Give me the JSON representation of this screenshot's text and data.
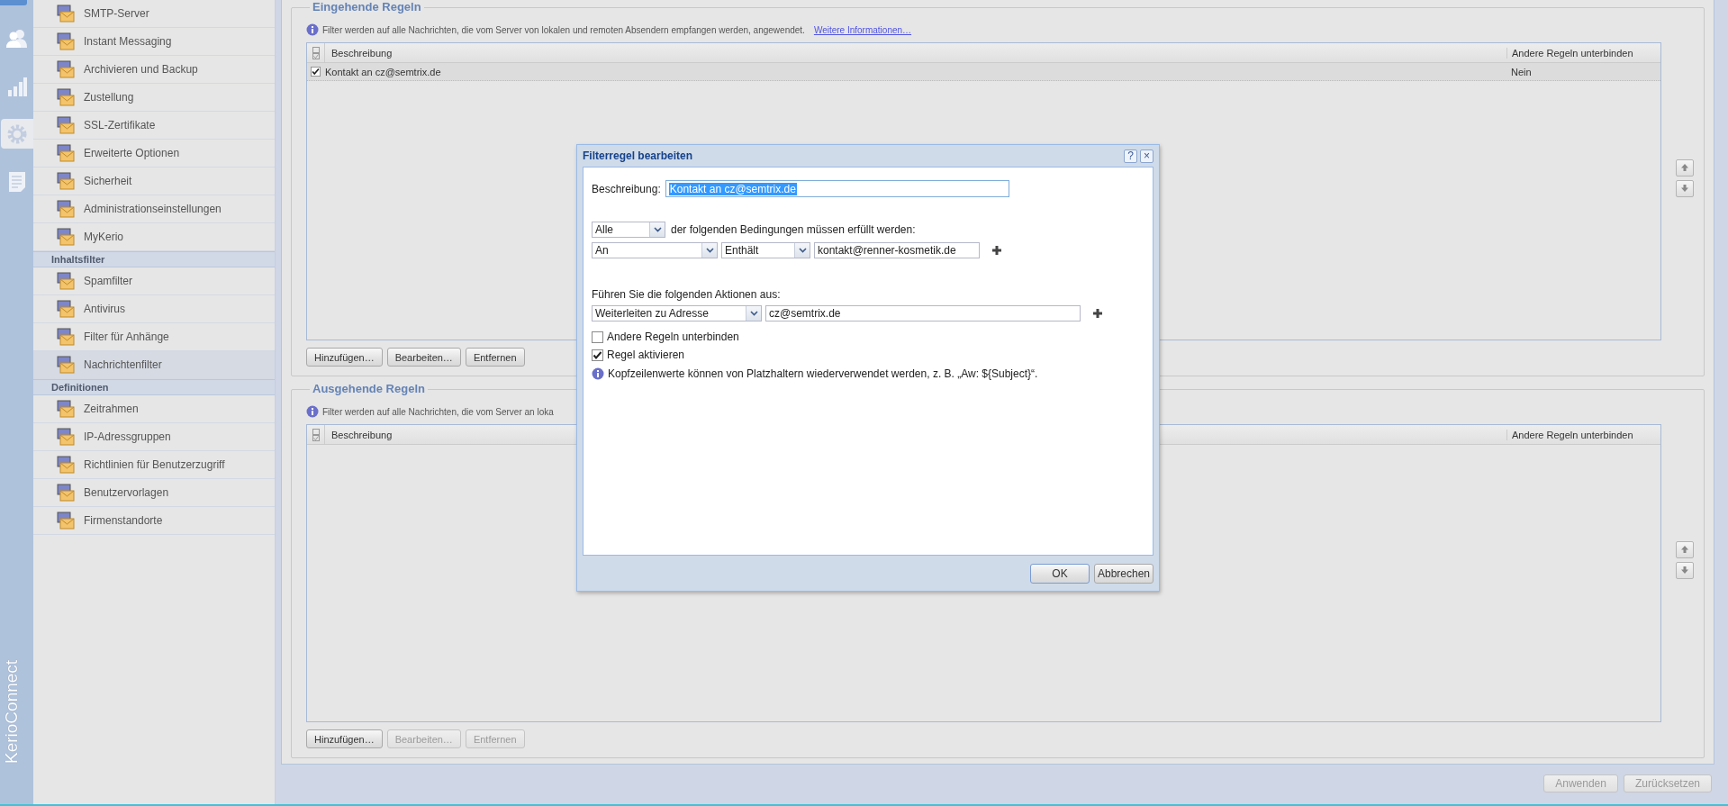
{
  "rail": {
    "items": [
      {
        "selected": false
      },
      {
        "selected": false
      },
      {
        "selected": true
      },
      {
        "selected": false
      }
    ],
    "brand": "KerioConnect"
  },
  "sidebar": {
    "groups": [
      {
        "items": [
          {
            "label": "SMTP-Server",
            "selected": false
          },
          {
            "label": "Instant Messaging",
            "selected": false
          },
          {
            "label": "Archivieren und Backup",
            "selected": false
          },
          {
            "label": "Zustellung",
            "selected": false
          },
          {
            "label": "SSL-Zertifikate",
            "selected": false
          },
          {
            "label": "Erweiterte Optionen",
            "selected": false
          },
          {
            "label": "Sicherheit",
            "selected": false
          },
          {
            "label": "Administrationseinstellungen",
            "selected": false
          },
          {
            "label": "MyKerio",
            "selected": false
          }
        ]
      },
      {
        "heading": "Inhaltsfilter",
        "items": [
          {
            "label": "Spamfilter",
            "selected": false
          },
          {
            "label": "Antivirus",
            "selected": false
          },
          {
            "label": "Filter für Anhänge",
            "selected": false
          },
          {
            "label": "Nachrichtenfilter",
            "selected": true
          }
        ]
      },
      {
        "heading": "Definitionen",
        "items": [
          {
            "label": "Zeitrahmen",
            "selected": false
          },
          {
            "label": "IP-Adressgruppen",
            "selected": false
          },
          {
            "label": "Richtlinien für Benutzerzugriff",
            "selected": false
          },
          {
            "label": "Benutzervorlagen",
            "selected": false
          },
          {
            "label": "Firmenstandorte",
            "selected": false
          }
        ]
      }
    ]
  },
  "incoming": {
    "title": "Eingehende Regeln",
    "info": "Filter werden auf alle Nachrichten, die vom Server von lokalen und remoten Absendern empfangen werden, angewendet.",
    "link": "Weitere Informationen…",
    "columns": [
      "Beschreibung",
      "Andere Regeln unterbinden"
    ],
    "rows": [
      {
        "enabled": true,
        "description": "Kontakt an cz@semtrix.de",
        "other_rules": "Nein"
      }
    ],
    "buttons": [
      {
        "label": "Hinzufügen…",
        "disabled": false
      },
      {
        "label": "Bearbeiten…",
        "disabled": false
      },
      {
        "label": "Entfernen",
        "disabled": false
      }
    ]
  },
  "outgoing": {
    "title": "Ausgehende Regeln",
    "info": "Filter werden auf alle Nachrichten, die vom Server an loka",
    "columns": [
      "Beschreibung",
      "Andere Regeln unterbinden"
    ],
    "buttons": [
      {
        "label": "Hinzufügen…",
        "disabled": false
      },
      {
        "label": "Bearbeiten…",
        "disabled": true
      },
      {
        "label": "Entfernen",
        "disabled": true
      }
    ]
  },
  "footer": {
    "buttons": [
      {
        "label": "Anwenden",
        "disabled": true
      },
      {
        "label": "Zurücksetzen",
        "disabled": true
      }
    ]
  },
  "dialog": {
    "title": "Filterregel bearbeiten",
    "help": "?",
    "close": "×",
    "description_label": "Beschreibung:",
    "description_value": "Kontakt an cz@semtrix.de",
    "match": "Alle",
    "match_text": "der folgenden Bedingungen müssen erfüllt werden:",
    "condition": {
      "field": "An",
      "operator": "Enthält",
      "value": "kontakt@renner-kosmetik.de"
    },
    "actions_label": "Führen Sie die folgenden Aktionen aus:",
    "action": {
      "type": "Weiterleiten zu Adresse",
      "value": "cz@semtrix.de"
    },
    "checkboxes": [
      {
        "label": "Andere Regeln unterbinden",
        "checked": false
      },
      {
        "label": "Regel aktivieren",
        "checked": true
      }
    ],
    "hint": "Kopfzeilenwerte können von Platzhaltern wiederverwendet werden, z. B. „Aw: ${Subject}“.",
    "buttons": [
      {
        "label": "OK",
        "default": true
      },
      {
        "label": "Abbrechen",
        "default": false
      }
    ]
  }
}
